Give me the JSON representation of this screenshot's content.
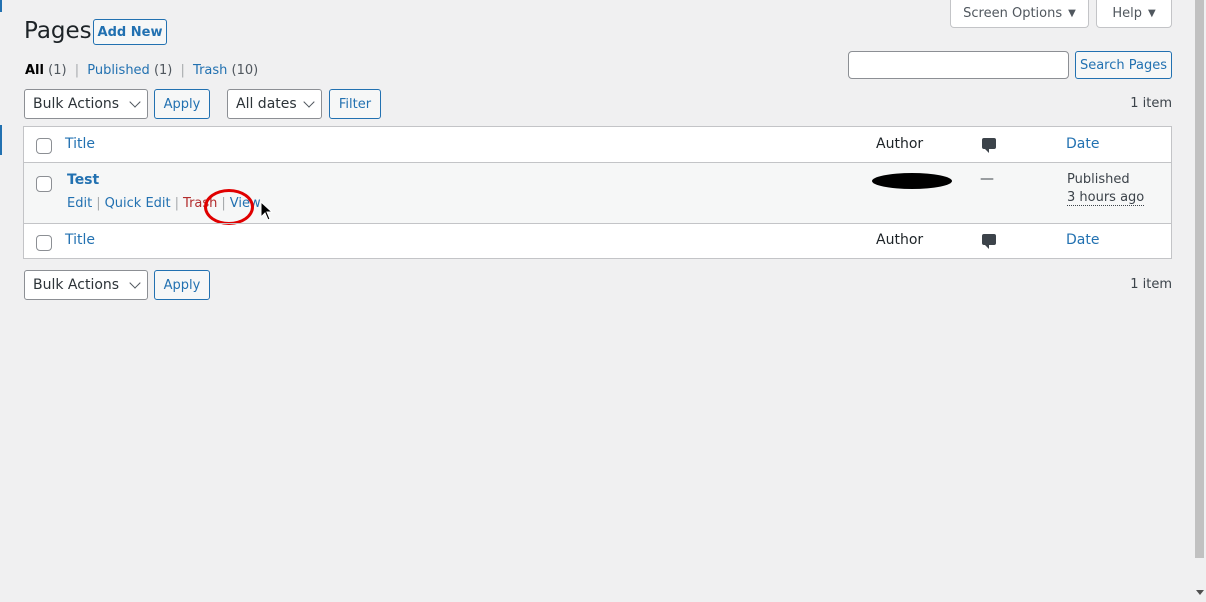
{
  "header": {
    "title": "Pages",
    "add_new": "Add New",
    "screen_options": "Screen Options",
    "help": "Help",
    "caret": "▼"
  },
  "views": {
    "all": {
      "label": "All",
      "count": "(1)"
    },
    "published": {
      "label": "Published",
      "count": "(1)"
    },
    "trash": {
      "label": "Trash",
      "count": "(10)"
    },
    "separator": "|"
  },
  "search": {
    "button": "Search Pages",
    "value": ""
  },
  "tablenav_top": {
    "bulk_actions": "Bulk Actions",
    "apply": "Apply",
    "dates": "All dates",
    "filter": "Filter",
    "items": "1 item"
  },
  "tablenav_bottom": {
    "bulk_actions": "Bulk Actions",
    "apply": "Apply",
    "items": "1 item"
  },
  "table": {
    "columns": {
      "title": "Title",
      "author": "Author",
      "comments_icon": "comment-bubble-icon",
      "date": "Date"
    },
    "rows": [
      {
        "title": "Test",
        "actions": {
          "edit": "Edit",
          "quick_edit": "Quick Edit",
          "trash": "Trash",
          "view": "View",
          "separator": "|"
        },
        "author": "",
        "comments": "—",
        "date_status": "Published",
        "date_ago": "3 hours ago"
      }
    ]
  },
  "colors": {
    "link": "#2271b1",
    "trash": "#b32d2e",
    "background": "#f0f0f1",
    "annotation": "#e00000"
  }
}
